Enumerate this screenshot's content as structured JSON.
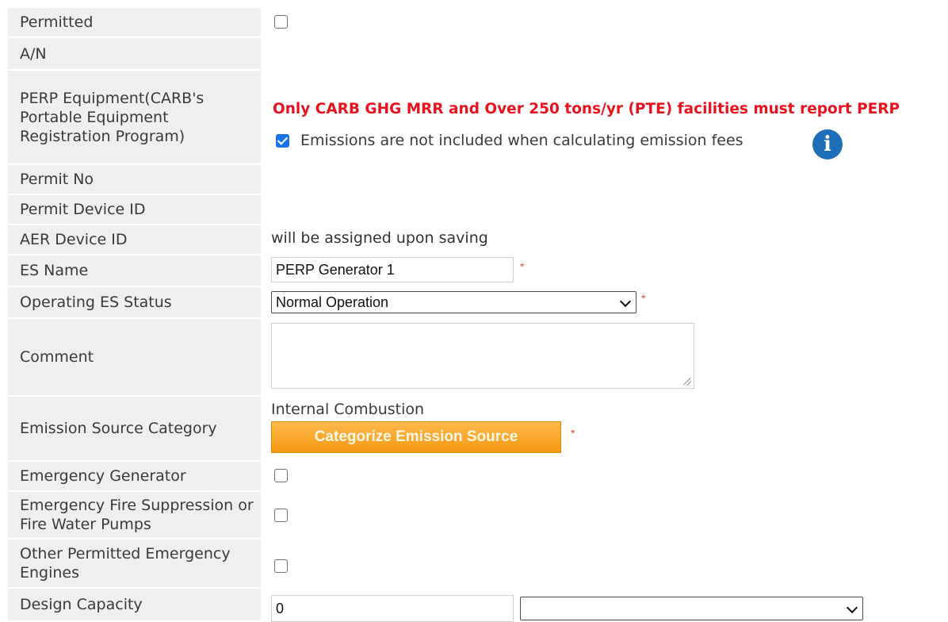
{
  "fields": {
    "permitted": {
      "label": "Permitted",
      "checked": false
    },
    "an": {
      "label": "A/N"
    },
    "perp": {
      "label": "PERP Equipment(CARB's Portable Equipment Registration Program)",
      "warning": "Only CARB GHG MRR and Over 250 tons/yr (PTE) facilities must report PERP",
      "checkbox_text": "Emissions are not included when calculating emission fees",
      "checked": true,
      "info_icon": "info-icon"
    },
    "permit_no": {
      "label": "Permit No"
    },
    "permit_device_id": {
      "label": "Permit Device ID"
    },
    "aer_device_id": {
      "label": "AER Device ID",
      "value": "will be assigned upon saving"
    },
    "es_name": {
      "label": "ES Name",
      "value": "PERP Generator 1",
      "required": "*"
    },
    "operating_status": {
      "label": "Operating ES Status",
      "selected": "Normal Operation",
      "required": "*"
    },
    "comment": {
      "label": "Comment",
      "value": ""
    },
    "source_category": {
      "label": "Emission Source Category",
      "value": "Internal Combustion",
      "button": "Categorize Emission Source",
      "required": "*"
    },
    "emergency_generator": {
      "label": "Emergency Generator",
      "checked": false
    },
    "fire_suppression": {
      "label": "Emergency Fire Suppression or Fire Water Pumps",
      "checked": false
    },
    "other_emergency": {
      "label": "Other Permitted Emergency Engines",
      "checked": false
    },
    "design_capacity": {
      "label": "Design Capacity",
      "value": "0",
      "unit_selected": ""
    }
  },
  "colors": {
    "accent_orange": "#f39a11",
    "warning_red": "#e8121f",
    "info_blue": "#1f6fb8",
    "checkbox_blue": "#1a73e8"
  }
}
